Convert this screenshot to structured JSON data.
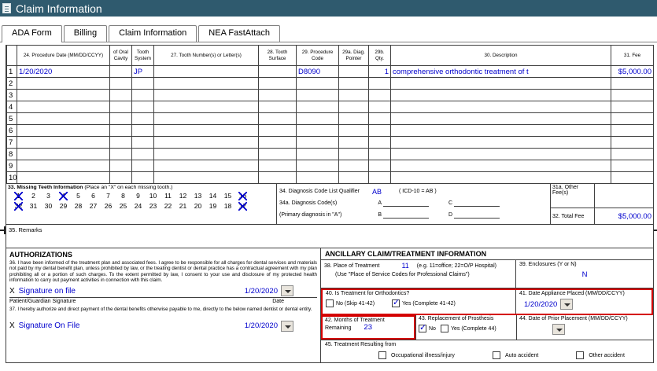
{
  "colors": {
    "titlebar_bg": "#2f5a6e",
    "entry_blue": "#0000cd",
    "highlight_red": "#d40000"
  },
  "titlebar": {
    "title": "Claim Information"
  },
  "tabs": [
    {
      "label": "ADA Form",
      "active": true
    },
    {
      "label": "Billing",
      "active": false
    },
    {
      "label": "Claim Information",
      "active": false
    },
    {
      "label": "NEA FastAttach",
      "active": false
    }
  ],
  "table": {
    "headers": {
      "date": "24. Procedure Date (MM/DD/CCYY)",
      "oral": "of Oral Cavity",
      "system": "Tooth System",
      "tooth": "27. Tooth Number(s) or Letter(s)",
      "surface": "28. Tooth Surface",
      "code": "29. Procedure Code",
      "pointer": "29a. Diag. Pointer",
      "qty": "29b. Qty.",
      "desc": "30. Description",
      "fee": "31. Fee"
    },
    "rows": [
      {
        "num": "1",
        "date": "1/20/2020",
        "oral": "",
        "system": "JP",
        "tooth": "",
        "surface": "",
        "code": "D8090",
        "pointer": "",
        "qty": "1",
        "desc": "comprehensive orthodontic treatment of t",
        "fee": "$5,000.00"
      },
      {
        "num": "2"
      },
      {
        "num": "3"
      },
      {
        "num": "4"
      },
      {
        "num": "5"
      },
      {
        "num": "6"
      },
      {
        "num": "7"
      },
      {
        "num": "8"
      },
      {
        "num": "9"
      },
      {
        "num": "10"
      }
    ]
  },
  "missing_teeth": {
    "label": "33. Missing Teeth Information",
    "hint": "(Place an \"X\" on each missing tooth.)",
    "top": [
      {
        "n": "1",
        "x": true
      },
      {
        "n": "2",
        "x": false
      },
      {
        "n": "3",
        "x": false
      },
      {
        "n": "4",
        "x": true
      },
      {
        "n": "5",
        "x": false
      },
      {
        "n": "6",
        "x": false
      },
      {
        "n": "7",
        "x": false
      },
      {
        "n": "8",
        "x": false
      },
      {
        "n": "9",
        "x": false
      },
      {
        "n": "10",
        "x": false
      },
      {
        "n": "11",
        "x": false
      },
      {
        "n": "12",
        "x": false
      },
      {
        "n": "13",
        "x": false
      },
      {
        "n": "14",
        "x": false
      },
      {
        "n": "15",
        "x": false
      },
      {
        "n": "16",
        "x": true
      }
    ],
    "bottom": [
      {
        "n": "32",
        "x": true
      },
      {
        "n": "31",
        "x": false
      },
      {
        "n": "30",
        "x": false
      },
      {
        "n": "29",
        "x": false
      },
      {
        "n": "28",
        "x": false
      },
      {
        "n": "27",
        "x": false
      },
      {
        "n": "26",
        "x": false
      },
      {
        "n": "25",
        "x": false
      },
      {
        "n": "24",
        "x": false
      },
      {
        "n": "23",
        "x": false
      },
      {
        "n": "22",
        "x": false
      },
      {
        "n": "21",
        "x": false
      },
      {
        "n": "20",
        "x": false
      },
      {
        "n": "19",
        "x": false
      },
      {
        "n": "18",
        "x": false
      },
      {
        "n": "17",
        "x": true
      }
    ]
  },
  "diagnosis": {
    "qualifier_label": "34. Diagnosis Code List Qualifier",
    "qualifier_value": "AB",
    "qualifier_hint": "( ICD-10 = AB )",
    "codes_label": "34a. Diagnosis Code(s)",
    "primary_label": "(Primary diagnosis in \"A\")",
    "slot_a": "A",
    "slot_b": "B",
    "slot_c": "C",
    "slot_d": "D"
  },
  "fees": {
    "other_label": "31a. Other Fee(s)",
    "total_label": "32. Total Fee",
    "total_value": "$5,000.00"
  },
  "remarks_label": "35. Remarks",
  "authorizations": {
    "header": "AUTHORIZATIONS",
    "item36": "36. I have been informed of the treatment plan and associated fees. I agree to be responsible for all charges for dental services and materials not paid by my dental benefit plan, unless prohibited by law, or the treating dentist or dental practice has a contractual agreement with my plan prohibiting all or a portion of such charges. To the extent permitted by law, I consent to your use and disclosure of my protected health information to carry out payment activities in connection with this claim.",
    "sig1_x": "X",
    "sig1_value": "Signature on file",
    "sig1_date": "1/20/2020",
    "sig1_line_label": "Patient/Guardian Signature",
    "sig1_date_label": "Date",
    "item37": "37. I hereby authorize and direct payment of the dental benefits otherwise payable to me, directly to the below named dentist or dental entity.",
    "sig2_x": "X",
    "sig2_value": "Signature On File",
    "sig2_date": "1/20/2020"
  },
  "ancillary": {
    "header": "ANCILLARY CLAIM/TREATMENT INFORMATION",
    "f38_label": "38. Place of Treatment",
    "f38_value": "11",
    "f38_hint": "(e.g. 11=office; 22=O/P Hospital)",
    "f38_hint2": "(Use \"Place of Service Codes for Professional Claims\")",
    "f39_label": "39. Enclosures (Y or N)",
    "f39_value": "N",
    "f40_label": "40. Is Treatment for Orthodontics?",
    "f40_no_label": "No  (Skip 41-42)",
    "f40_no_checked": false,
    "f40_yes_label": "Yes (Complete 41-42)",
    "f40_yes_checked": true,
    "f41_label": "41. Date Appliance Placed (MM/DD/CCYY)",
    "f41_value": "1/20/2020",
    "f42_label": "42. Months of Treatment Remaining",
    "f42_value": "23",
    "f43_label": "43. Replacement of Prosthesis",
    "f43_no_label": "No",
    "f43_no_checked": true,
    "f43_yes_label": "Yes (Complete 44)",
    "f43_yes_checked": false,
    "f44_label": "44. Date of Prior Placement (MM/DD/CCYY)",
    "f45_label": "45. Treatment Resulting from",
    "f45_options": [
      {
        "label": "Occupational illness/injury",
        "checked": false
      },
      {
        "label": "Auto accident",
        "checked": false
      },
      {
        "label": "Other accident",
        "checked": false
      }
    ]
  }
}
